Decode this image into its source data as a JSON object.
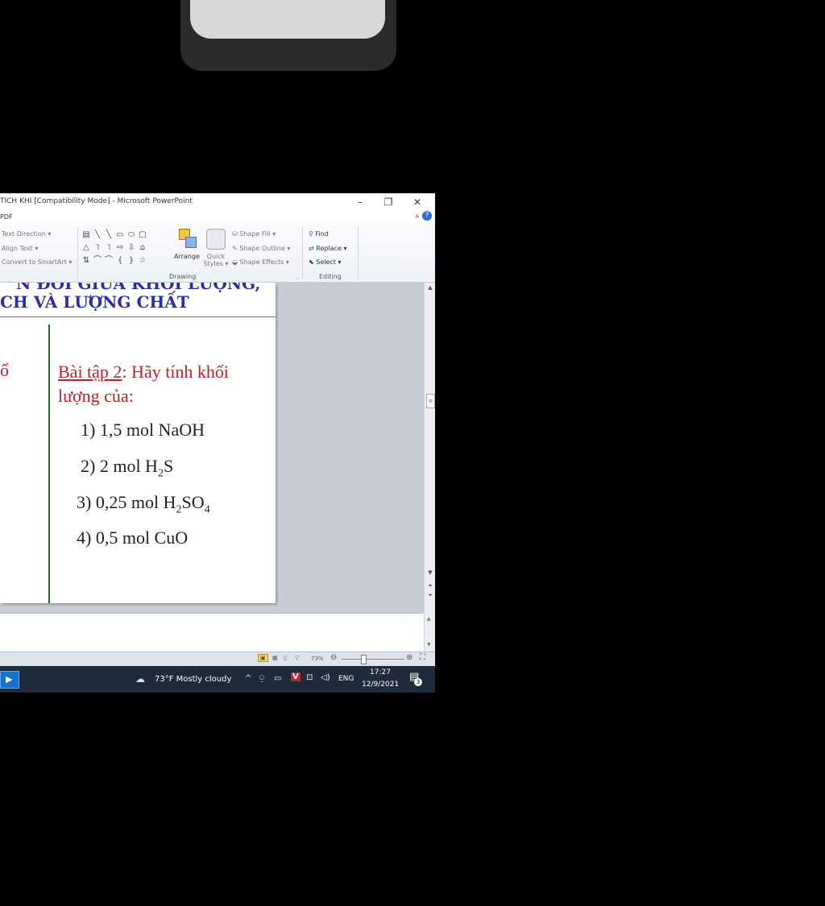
{
  "window": {
    "title": "TICH KHI [Compatibility Mode] - Microsoft PowerPoint",
    "minimize": "–",
    "restore": "❐",
    "close": "✕",
    "tab_fragment": "PDF",
    "help": "?"
  },
  "ribbon": {
    "paragraph": {
      "text_direction": "Text Direction ▾",
      "align_text": "Align Text ▾",
      "convert_smartart": "Convert to SmartArt ▾"
    },
    "drawing": {
      "label": "Drawing",
      "arrange": "Arrange",
      "quick_styles": "Quick Styles ▾",
      "shape_fill": "Shape Fill ▾",
      "shape_outline": "Shape Outline ▾",
      "shape_effects": "Shape Effects ▾"
    },
    "editing": {
      "label": "Editing",
      "find": "Find",
      "replace": "Replace ▾",
      "select": "Select ▾"
    }
  },
  "slide": {
    "title_line1": "N ĐỔI GIỮA KHỐI LƯỢNG,",
    "title_line2": "CH VÀ LƯỢNG CHẤT",
    "left_fragment": "ố",
    "exercise_label": "Bài tập 2",
    "exercise_text": ": Hãy tính khối lượng của:",
    "items": [
      {
        "prefix": "1) 1,5 mol NaOH"
      },
      {
        "prefix": "2) 2 mol H",
        "s1": "2",
        "mid": "S"
      },
      {
        "prefix": "3) 0,25 mol H",
        "s1": "2",
        "mid": "SO",
        "s2": "4"
      },
      {
        "prefix": "4) 0,5 mol CuO"
      }
    ]
  },
  "status": {
    "zoom": "73%"
  },
  "taskbar": {
    "weather": "73°F  Mostly cloudy",
    "tray_caret": "^",
    "lang": "ENG",
    "time": "17:27",
    "date": "12/9/2021",
    "notification_count": "3"
  }
}
